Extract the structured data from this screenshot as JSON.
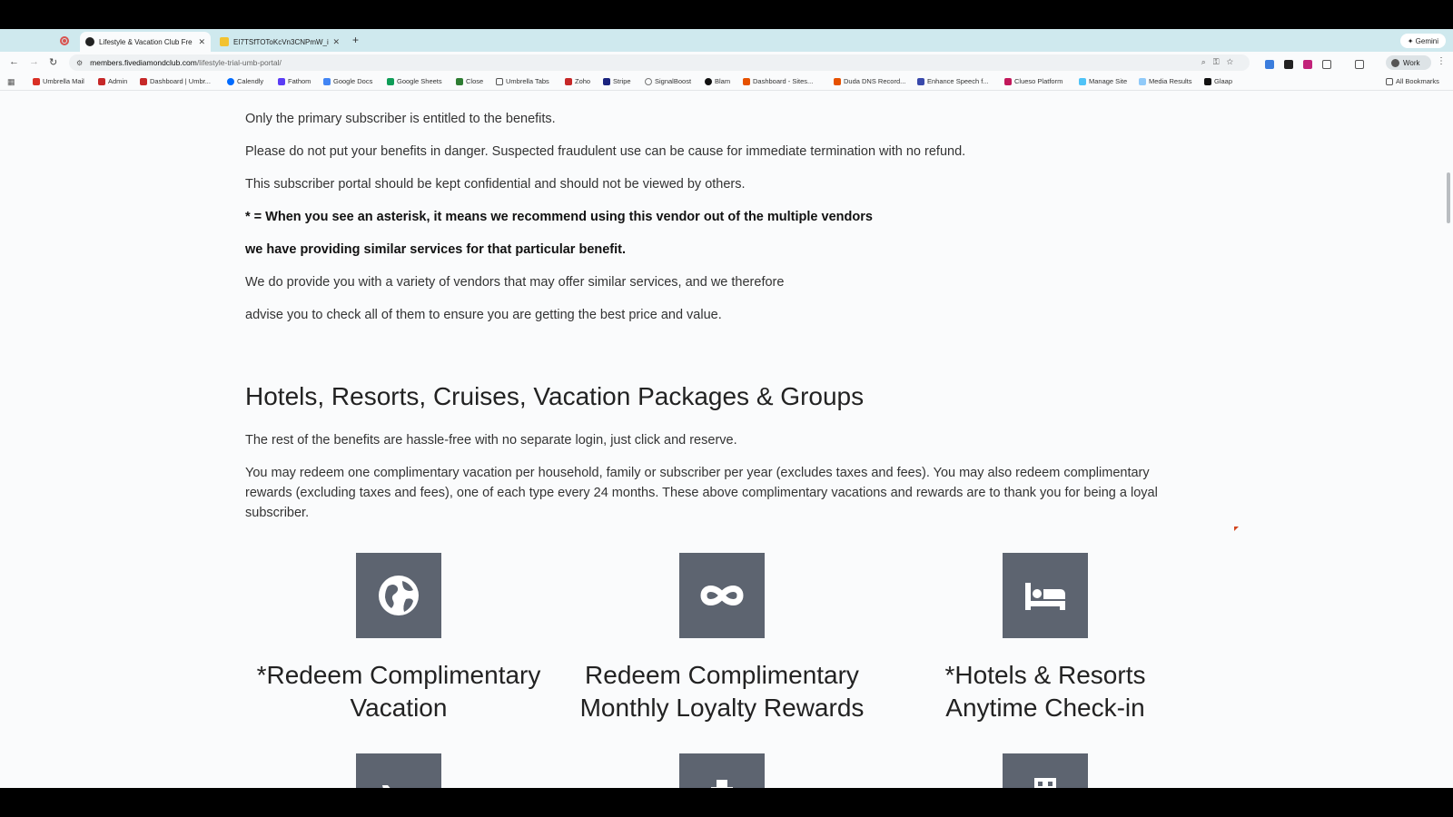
{
  "tabs": [
    {
      "title": "Lifestyle & Vacation Club Fre",
      "close": "✕"
    },
    {
      "title": "EI7TSfTOToKcVn3CNPmW_i",
      "close": "✕"
    }
  ],
  "new_tab": "+",
  "gemini_label": "✦ Gemini",
  "address": {
    "host": "members.fivediamondclub.com",
    "path": "/lifestyle-trial-umb-portal/"
  },
  "profile_label": "Work",
  "bookmarks": [
    "Umbrella Mail",
    "Admin",
    "Dashboard | Umbr...",
    "Calendly",
    "Fathom",
    "Google Docs",
    "Google Sheets",
    "Close",
    "Umbrella Tabs",
    "Zoho",
    "Stripe",
    "SignalBoost",
    "Blam",
    "Dashboard - Sites...",
    "Duda DNS Record...",
    "Enhance Speech f...",
    "Clueso Platform",
    "Manage Site",
    "Media Results",
    "Glaap"
  ],
  "all_bookmarks": "All Bookmarks",
  "content": {
    "p1": "Only the primary subscriber is entitled to the benefits.",
    "p2": "Please do not put your benefits in danger.  Suspected fraudulent use can be cause for immediate termination with no refund.",
    "p3": "This subscriber portal should be kept confidential and should not be viewed by others.",
    "p4": "* = When you see an asterisk, it means we recommend using this vendor out of the multiple vendors",
    "p5": "we have providing similar services for that particular benefit.",
    "p6": "We do provide you with a variety of vendors that may offer similar services, and we therefore",
    "p7": "advise you to check all of them to ensure you are getting the best price and value.",
    "heading": "Hotels, Resorts, Cruises, Vacation Packages & Groups",
    "p8": "The rest of the benefits are hassle-free with no separate login, just click and reserve.",
    "p9": "You may redeem one complimentary vacation per household, family or subscriber per year (excludes taxes and fees).  You may also redeem complimentary rewards (excluding taxes and fees), one of each type every 24 months.  These above complimentary vacations and rewards are to thank you for being a loyal subscriber."
  },
  "benefits": [
    {
      "label_line1": "*Redeem Complimentary",
      "label_line2": "Vacation",
      "icon": "globe-icon"
    },
    {
      "label_line1": "Redeem Complimentary",
      "label_line2": "Monthly Loyalty Rewards",
      "icon": "infinity-icon"
    },
    {
      "label_line1": "*Hotels & Resorts",
      "label_line2": "Anytime Check-in",
      "icon": "bed-icon"
    },
    {
      "icon": "plane-landing-icon"
    },
    {
      "icon": "ship-icon"
    },
    {
      "icon": "building-icon"
    }
  ]
}
